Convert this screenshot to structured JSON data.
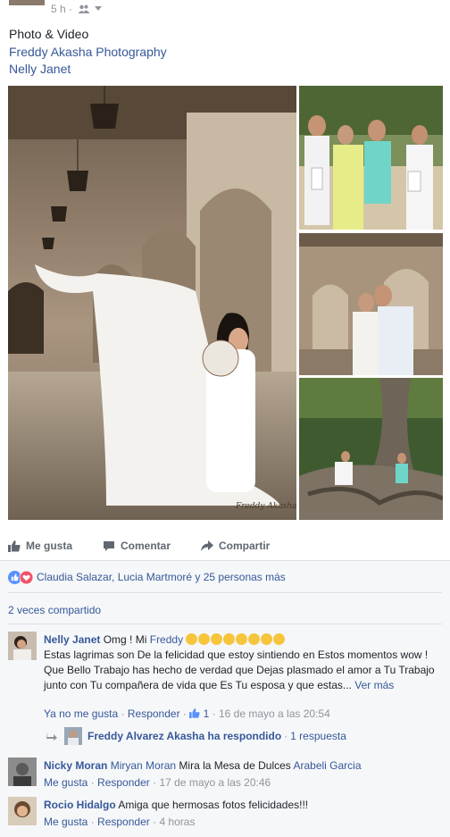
{
  "header": {
    "timestamp": "5 h ·",
    "audience_icon": "friends-icon",
    "caret_icon": "caret-down-icon"
  },
  "post": {
    "line1": "Photo & Video",
    "line2": "Freddy Akasha Photography",
    "line3": "Nelly Janet"
  },
  "actions": {
    "like": "Me gusta",
    "comment": "Comentar",
    "share": "Compartir"
  },
  "reactions": {
    "text": "Claudia Salazar, Lucia Martmoré y 25 personas más"
  },
  "shares": {
    "text": "2 veces compartido"
  },
  "comments": [
    {
      "name": "Nelly Janet",
      "text_a": "Omg ! Mi",
      "mention": "Freddy",
      "text_b": "Estas lagrimas son De la felicidad que estoy sintiendo en Estos momentos wow ! Que Bello Trabajo has hecho de verdad que Dejas plasmado el amor a Tu Trabajo junto con Tu compañera de vida que Es Tu esposa y que estas...",
      "see_more": "Ver más",
      "meta_unlike": "Ya no me gusta",
      "meta_reply": "Responder",
      "meta_likes": "1",
      "meta_time": "16 de mayo a las 20:54",
      "reply_name": "Freddy Alvarez Akasha ha respondido",
      "reply_count": "1 respuesta"
    },
    {
      "name": "Nicky Moran",
      "mention1": "Miryan Moran",
      "text": "Mira la Mesa de Dulces",
      "mention2": "Arabeli Garcia",
      "meta_like": "Me gusta",
      "meta_reply": "Responder",
      "meta_time": "17 de mayo a las 20:46"
    },
    {
      "name": "Rocio Hidalgo",
      "text": "Amiga que hermosas fotos felicidades!!!",
      "meta_like": "Me gusta",
      "meta_reply": "Responder",
      "meta_time": "4 horas"
    }
  ],
  "photos": {
    "watermark": "Freddy Akasha"
  },
  "colors": {
    "link": "#365899",
    "muted": "#90949c",
    "like_blue": "#5890ff",
    "love_red": "#f25268"
  }
}
